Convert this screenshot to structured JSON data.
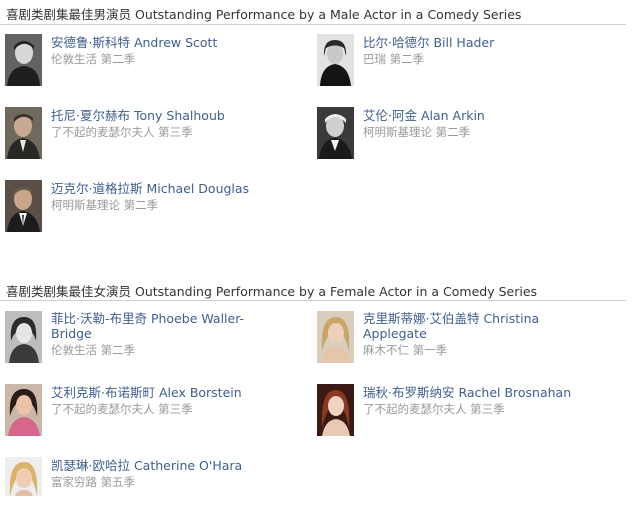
{
  "male_section": {
    "title": "喜剧类剧集最佳男演员 Outstanding Performance by a Male Actor in a Comedy Series",
    "nominees": [
      {
        "name": "安德鲁·斯科特 Andrew Scott",
        "show": "伦敦生活 第二季"
      },
      {
        "name": "比尔·哈德尔 Bill Hader",
        "show": "巴瑞 第二季"
      },
      {
        "name": "托尼·夏尔赫布 Tony Shalhoub",
        "show": "了不起的麦瑟尔夫人 第三季"
      },
      {
        "name": "艾伦·阿金 Alan Arkin",
        "show": "柯明斯基理论 第二季"
      },
      {
        "name": "迈克尔·道格拉斯 Michael Douglas",
        "show": "柯明斯基理论 第二季"
      }
    ]
  },
  "female_section": {
    "title": "喜剧类剧集最佳女演员 Outstanding Performance by a Female Actor in a Comedy Series",
    "nominees": [
      {
        "name": "菲比·沃勒-布里奇 Phoebe Waller-Bridge",
        "show": "伦敦生活 第二季"
      },
      {
        "name": "克里斯蒂娜·艾伯盖特 Christina Applegate",
        "show": "麻木不仁 第一季"
      },
      {
        "name": "艾利克斯·布诺斯町 Alex Borstein",
        "show": "了不起的麦瑟尔夫人 第三季"
      },
      {
        "name": "瑞秋·布罗斯纳安 Rachel Brosnahan",
        "show": "了不起的麦瑟尔夫人 第三季"
      },
      {
        "name": "凯瑟琳·欧哈拉 Catherine O'Hara",
        "show": "富家穷路 第五季"
      }
    ]
  },
  "colors": {
    "name_link": "#3e5f90",
    "show_text": "#9a9a9a",
    "title_text": "#333333",
    "divider": "#cfcfcf"
  },
  "icons": [
    "portrait-photo"
  ]
}
